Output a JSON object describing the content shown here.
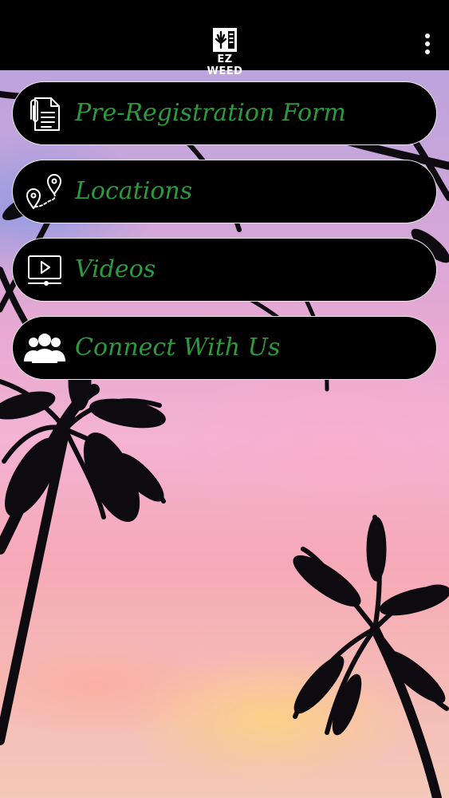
{
  "app": {
    "brand": "EZ WEED"
  },
  "nav": {
    "items": [
      {
        "label": "Pre-Registration Form",
        "icon": "document-icon"
      },
      {
        "label": "Locations",
        "icon": "map-route-icon"
      },
      {
        "label": "Videos",
        "icon": "video-player-icon"
      },
      {
        "label": "Connect With Us",
        "icon": "group-icon"
      }
    ]
  },
  "colors": {
    "label_green": "#2c9a3e",
    "button_bg": "#000000",
    "button_border": "#e6e6e6",
    "topbar_bg": "#000000"
  }
}
